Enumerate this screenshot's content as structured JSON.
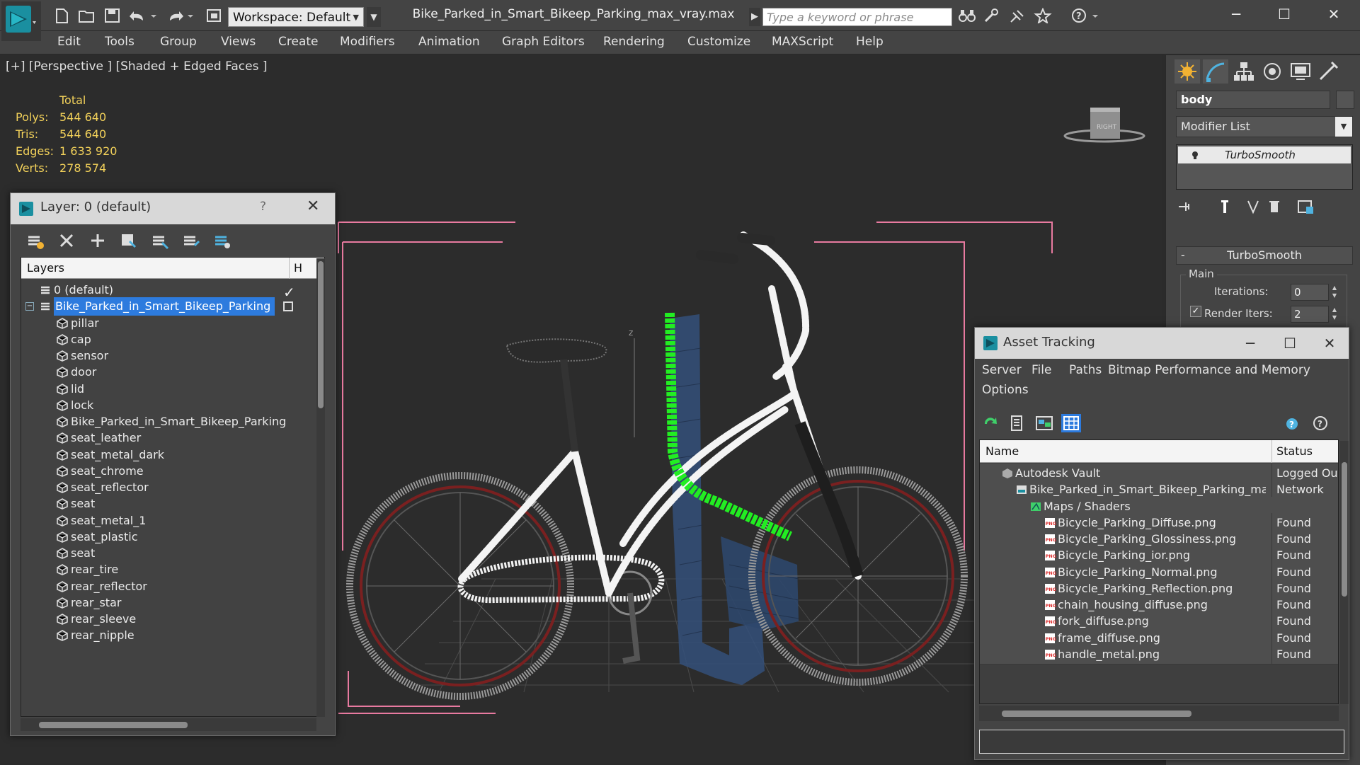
{
  "title_bar": {
    "workspace": "Workspace: Default",
    "file_title": "Bike_Parked_in_Smart_Bikeep_Parking_max_vray.max",
    "search_placeholder": "Type a keyword or phrase"
  },
  "menu": [
    "Edit",
    "Tools",
    "Group",
    "Views",
    "Create",
    "Modifiers",
    "Animation",
    "Graph Editors",
    "Rendering",
    "Customize",
    "MAXScript",
    "Help"
  ],
  "viewport": {
    "label": "[+] [Perspective ] [Shaded + Edged Faces ]",
    "stats": {
      "total_label": "Total",
      "rows": [
        {
          "label": "Polys:",
          "value": "544 640"
        },
        {
          "label": "Tris:",
          "value": "544 640"
        },
        {
          "label": "Edges:",
          "value": "1 633 920"
        },
        {
          "label": "Verts:",
          "value": "278 574"
        }
      ]
    },
    "viewcube_label": "RIGHT",
    "axis_label": "z"
  },
  "command_panel": {
    "object_name": "body",
    "modifier_list": "Modifier List",
    "stack_item": "TurboSmooth",
    "rollout_title": "TurboSmooth",
    "rollout_toggle": "-",
    "group_label": "Main",
    "iterations_label": "Iterations:",
    "iterations_value": "0",
    "render_iters_label": "Render Iters:",
    "render_iters_value": "2"
  },
  "layer_dialog": {
    "title": "Layer: 0 (default)",
    "help": "?",
    "header": "Layers",
    "header_col2": "H",
    "rows": [
      {
        "name": "0 (default)",
        "type": "layer",
        "indent": 0
      },
      {
        "name": "Bike_Parked_in_Smart_Bikeep_Parking",
        "type": "layer",
        "indent": 0,
        "selected": true
      },
      {
        "name": "pillar",
        "type": "object",
        "indent": 1
      },
      {
        "name": "cap",
        "type": "object",
        "indent": 1
      },
      {
        "name": "sensor",
        "type": "object",
        "indent": 1
      },
      {
        "name": "door",
        "type": "object",
        "indent": 1
      },
      {
        "name": "lid",
        "type": "object",
        "indent": 1
      },
      {
        "name": "lock",
        "type": "object",
        "indent": 1
      },
      {
        "name": "Bike_Parked_in_Smart_Bikeep_Parking",
        "type": "object",
        "indent": 1
      },
      {
        "name": "seat_leather",
        "type": "object",
        "indent": 1
      },
      {
        "name": "seat_metal_dark",
        "type": "object",
        "indent": 1
      },
      {
        "name": "seat_chrome",
        "type": "object",
        "indent": 1
      },
      {
        "name": "seat_reflector",
        "type": "object",
        "indent": 1
      },
      {
        "name": "seat",
        "type": "object",
        "indent": 1
      },
      {
        "name": "seat_metal_1",
        "type": "object",
        "indent": 1
      },
      {
        "name": "seat_plastic",
        "type": "object",
        "indent": 1
      },
      {
        "name": "seat",
        "type": "object",
        "indent": 1
      },
      {
        "name": "rear_tire",
        "type": "object",
        "indent": 1
      },
      {
        "name": "rear_reflector",
        "type": "object",
        "indent": 1
      },
      {
        "name": "rear_star",
        "type": "object",
        "indent": 1
      },
      {
        "name": "rear_sleeve",
        "type": "object",
        "indent": 1
      },
      {
        "name": "rear_nipple",
        "type": "object",
        "indent": 1
      }
    ]
  },
  "asset_tracking": {
    "title": "Asset Tracking",
    "menu": [
      "Server",
      "File",
      "Paths",
      "Bitmap Performance and Memory",
      "Options"
    ],
    "col_name": "Name",
    "col_status": "Status",
    "rows": [
      {
        "name": "Autodesk Vault",
        "status": "Logged Out",
        "icon": "vault",
        "indent": 0
      },
      {
        "name": "Bike_Parked_in_Smart_Bikeep_Parking_max_vray.max",
        "status": "Network",
        "icon": "max-file",
        "indent": 1
      },
      {
        "name": "Maps / Shaders",
        "status": "",
        "icon": "maps",
        "indent": 2
      },
      {
        "name": "Bicycle_Parking_Diffuse.png",
        "status": "Found",
        "icon": "png",
        "indent": 3
      },
      {
        "name": "Bicycle_Parking_Glossiness.png",
        "status": "Found",
        "icon": "png",
        "indent": 3
      },
      {
        "name": "Bicycle_Parking_ior.png",
        "status": "Found",
        "icon": "png",
        "indent": 3
      },
      {
        "name": "Bicycle_Parking_Normal.png",
        "status": "Found",
        "icon": "png",
        "indent": 3
      },
      {
        "name": "Bicycle_Parking_Reflection.png",
        "status": "Found",
        "icon": "png",
        "indent": 3
      },
      {
        "name": "chain_housing_diffuse.png",
        "status": "Found",
        "icon": "png",
        "indent": 3
      },
      {
        "name": "fork_diffuse.png",
        "status": "Found",
        "icon": "png",
        "indent": 3
      },
      {
        "name": "frame_diffuse.png",
        "status": "Found",
        "icon": "png",
        "indent": 3
      },
      {
        "name": "handle_metal.png",
        "status": "Found",
        "icon": "png",
        "indent": 3
      }
    ]
  },
  "colors": {
    "selection": "#2d7bde",
    "stats_yellow": "#f2d15a",
    "frame_wire": "#ffffff",
    "selected_wire": "#22ee22",
    "pillar_blue": "#34507a",
    "bbox_pink": "#e87aa0"
  }
}
